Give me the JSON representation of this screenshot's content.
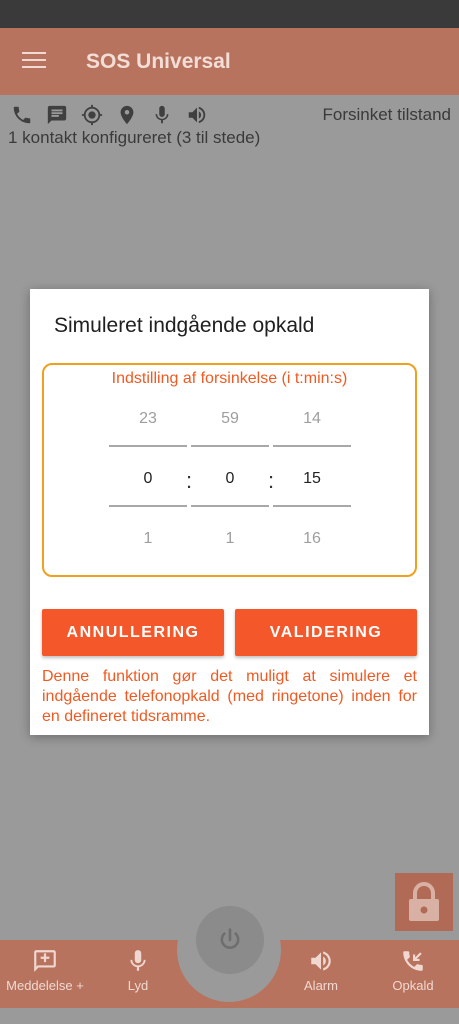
{
  "app": {
    "title": "SOS Universal",
    "menu_icon": "hamburger-menu-icon"
  },
  "status": {
    "icons": [
      "phone-icon",
      "message-icon",
      "gps-target-icon",
      "location-pin-icon",
      "microphone-icon",
      "speaker-icon"
    ],
    "state_text": "Forsinket tilstand",
    "contacts_text": "1 kontakt konfigureret (3 til stede)"
  },
  "dialog": {
    "title": "Simuleret indgående opkald",
    "picker_label": "Indstilling af forsinkelse (i t:min:s)",
    "hours": {
      "prev": "23",
      "current": "0",
      "next": "1"
    },
    "minutes": {
      "prev": "59",
      "current": "0",
      "next": "1"
    },
    "seconds": {
      "prev": "14",
      "current": "15",
      "next": "16"
    },
    "separator": ":",
    "cancel_label": "ANNULLERING",
    "confirm_label": "VALIDERING",
    "description": "Denne funktion gør det muligt at simulere et indgående telefonopkald (med ringetone) inden for en defineret tidsramme."
  },
  "bottom_nav": {
    "message": {
      "label": "Meddelelse +",
      "icon": "add-message-icon"
    },
    "sound": {
      "label": "Lyd",
      "icon": "microphone-icon"
    },
    "alarm": {
      "label": "Alarm",
      "icon": "speaker-icon"
    },
    "call": {
      "label": "Opkald",
      "icon": "incoming-call-icon"
    },
    "power_icon": "power-icon",
    "lock_icon": "lock-icon"
  },
  "colors": {
    "accent": "#f4582a",
    "picker_border": "#f0a020",
    "appbar_dimmed": "#b8735f",
    "scrim_background": "#9a9a9a"
  }
}
